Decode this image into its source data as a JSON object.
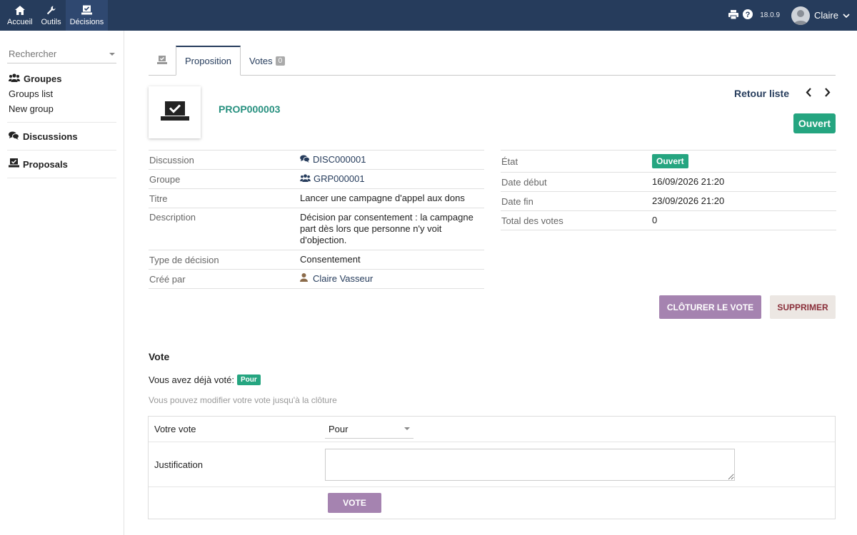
{
  "topnav": {
    "items": [
      {
        "label": "Accueil",
        "icon": "home-icon"
      },
      {
        "label": "Outils",
        "icon": "wrench-icon"
      },
      {
        "label": "Décisions",
        "icon": "vote-box-icon"
      }
    ],
    "version": "18.0.9",
    "user": "Claire"
  },
  "sidebar": {
    "search_placeholder": "Rechercher",
    "groups_title": "Groupes",
    "groups_items": [
      "Groups list",
      "New group"
    ],
    "discussions_title": "Discussions",
    "proposals_title": "Proposals"
  },
  "tabs": {
    "proposition": "Proposition",
    "votes": "Votes",
    "votes_count": "0"
  },
  "header": {
    "ref": "PROP000003",
    "retour": "Retour liste",
    "status": "Ouvert"
  },
  "left_props": [
    {
      "key": "Discussion",
      "value": "DISC000001"
    },
    {
      "key": "Groupe",
      "value": "GRP000001"
    },
    {
      "key": "Titre",
      "value": "Lancer une campagne d'appel aux dons"
    },
    {
      "key": "Description",
      "value": "Décision par consentement : la campagne part dès lors que personne n'y voit d'objection."
    },
    {
      "key": "Type de décision",
      "value": "Consentement"
    },
    {
      "key": "Créé par",
      "value": "Claire Vasseur"
    }
  ],
  "right_props": [
    {
      "key": "État",
      "value": "Ouvert"
    },
    {
      "key": "Date début",
      "value": "16/09/2026 21:20"
    },
    {
      "key": "Date fin",
      "value": "23/09/2026 21:20"
    },
    {
      "key": "Total des votes",
      "value": "0"
    }
  ],
  "actions": {
    "close_vote": "CLÔTURER LE VOTE",
    "delete": "SUPPRIMER"
  },
  "vote": {
    "title": "Vote",
    "already_voted": "Vous avez déjà voté:",
    "current_vote": "Pour",
    "hint": "Vous pouvez modifier votre vote jusqu'à la clôture",
    "field_vote_label": "Votre vote",
    "field_vote_value": "Pour",
    "field_justification_label": "Justification",
    "submit": "VOTE"
  },
  "colors": {
    "topbar": "#263c5c",
    "accent_green": "#25a580",
    "accent_purple": "#a583b0"
  }
}
